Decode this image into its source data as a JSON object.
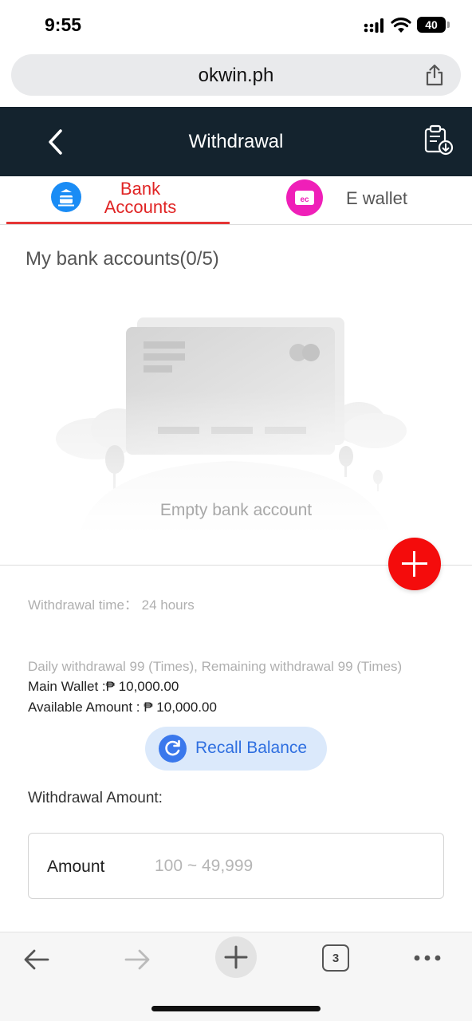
{
  "status_bar": {
    "time": "9:55",
    "battery": "40"
  },
  "browser": {
    "url": "okwin.ph",
    "tab_count": "3"
  },
  "header": {
    "title": "Withdrawal"
  },
  "tabs": [
    {
      "label": "Bank Accounts",
      "active": true
    },
    {
      "label": "E wallet",
      "active": false
    }
  ],
  "bank": {
    "title": "My bank accounts(0/5)",
    "empty_text": "Empty bank account"
  },
  "withdrawal": {
    "time": "Withdrawal time： 24 hours",
    "daily": "Daily withdrawal 99 (Times), Remaining withdrawal 99 (Times)",
    "main_wallet": "Main Wallet :₱ 10,000.00",
    "available": "Available Amount : ₱ 10,000.00",
    "recall_label": "Recall Balance",
    "amount_title": "Withdrawal Amount:",
    "amount_label": "Amount",
    "amount_placeholder": "100 ~ 49,999"
  },
  "colors": {
    "accent": "#e02424",
    "header_bg": "#14232e",
    "recall": "#2f6fe0"
  }
}
